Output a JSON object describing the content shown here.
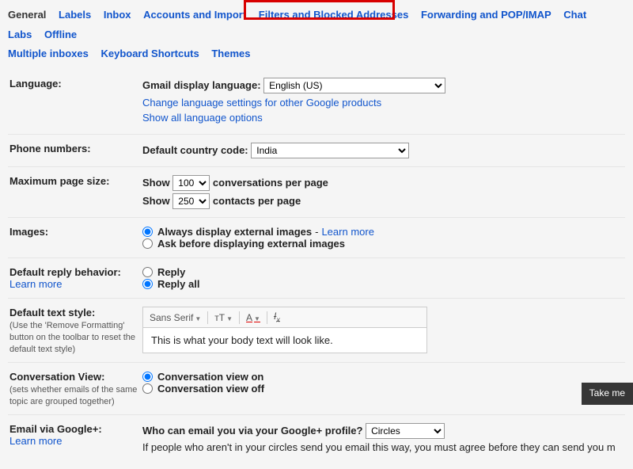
{
  "tabs": {
    "general": "General",
    "labels": "Labels",
    "inbox": "Inbox",
    "accounts": "Accounts and Import",
    "filters": "Filters and Blocked Addresses",
    "forwarding": "Forwarding and POP/IMAP",
    "chat": "Chat",
    "labs": "Labs",
    "offline": "Offline",
    "multiple_inboxes": "Multiple inboxes",
    "keyboard": "Keyboard Shortcuts",
    "themes": "Themes"
  },
  "language": {
    "label": "Language:",
    "display_label": "Gmail display language:",
    "selected": "English (US)",
    "change_link": "Change language settings for other Google products",
    "show_all_link": "Show all language options"
  },
  "phone": {
    "label": "Phone numbers:",
    "code_label": "Default country code:",
    "selected": "India"
  },
  "pagesize": {
    "label": "Maximum page size:",
    "show": "Show",
    "conv_value": "100",
    "conv_suffix": "conversations per page",
    "contacts_value": "250",
    "contacts_suffix": "contacts per page"
  },
  "images": {
    "label": "Images:",
    "always": "Always display external images",
    "dash": " - ",
    "learn": "Learn more",
    "ask": "Ask before displaying external images"
  },
  "reply": {
    "label": "Default reply behavior:",
    "learn": "Learn more",
    "reply": "Reply",
    "reply_all": "Reply all"
  },
  "textstyle": {
    "label": "Default text style:",
    "sub": "(Use the 'Remove Formatting' button on the toolbar to reset the default text style)",
    "font": "Sans Serif",
    "preview": "This is what your body text will look like."
  },
  "conversation": {
    "label": "Conversation View:",
    "sub": "(sets whether emails of the same topic are grouped together)",
    "on": "Conversation view on",
    "off": "Conversation view off"
  },
  "gplus": {
    "label": "Email via Google+:",
    "learn": "Learn more",
    "question": "Who can email you via your Google+ profile?",
    "selected": "Circles",
    "note": "If people who aren't in your circles send you email this way, you must agree before they can send you m"
  },
  "takeme": "Take me"
}
